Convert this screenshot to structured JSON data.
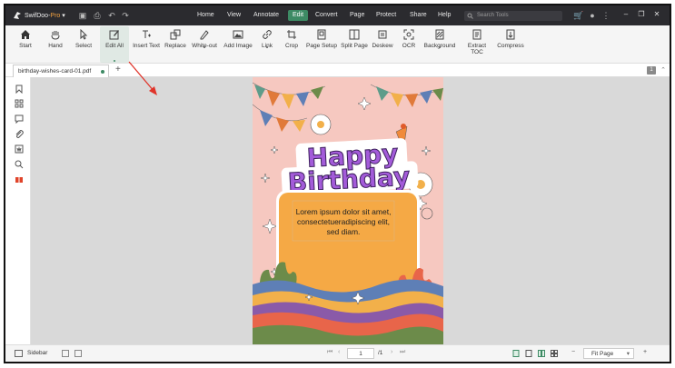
{
  "titlebar": {
    "app_name_prefix": "SwifDoo",
    "app_name_suffix": "Pro",
    "menus": [
      "Home",
      "View",
      "Annotate",
      "Edit",
      "Convert",
      "Page",
      "Protect",
      "Share",
      "Help"
    ],
    "active_menu": "Edit",
    "search_placeholder": "Search Tools"
  },
  "toolbar": {
    "tools": [
      {
        "label": "Start",
        "icon": "home-icon"
      },
      {
        "label": "Hand",
        "icon": "hand-icon"
      },
      {
        "label": "Select",
        "icon": "cursor-icon"
      },
      {
        "label": "Edit All",
        "icon": "edit-all-icon"
      },
      {
        "label": "Insert Text",
        "icon": "insert-text-icon"
      },
      {
        "label": "Replace",
        "icon": "replace-icon"
      },
      {
        "label": "White-out",
        "icon": "white-out-icon"
      },
      {
        "label": "Add Image",
        "icon": "add-image-icon"
      },
      {
        "label": "Link",
        "icon": "link-icon"
      },
      {
        "label": "Crop",
        "icon": "crop-icon"
      },
      {
        "label": "Page Setup",
        "icon": "page-setup-icon"
      },
      {
        "label": "Split Page",
        "icon": "split-page-icon"
      },
      {
        "label": "Deskew",
        "icon": "deskew-icon"
      },
      {
        "label": "OCR",
        "icon": "ocr-icon"
      },
      {
        "label": "Background",
        "icon": "background-icon"
      },
      {
        "label": "Extract TOC",
        "icon": "extract-toc-icon"
      },
      {
        "label": "Compress",
        "icon": "compress-icon"
      }
    ]
  },
  "tabs": {
    "file_name": "birthday-wishes-card-01.pdf",
    "page_count_badge": "1"
  },
  "document": {
    "title_line1": "Happy",
    "title_line2": "Birthday",
    "body_line1": "Lorem ipsum dolor sit amet,",
    "body_line2": "consectetueradipiscing elit,",
    "body_line3": "sed diam."
  },
  "statusbar": {
    "sidebar_label": "Sidebar",
    "current_page": "1",
    "total_pages": "/1",
    "zoom": "Fit Page"
  },
  "colors": {
    "accent": "#3d8a64",
    "titlebar_bg": "#2b2b2f",
    "card_bg": "#f6c8c0",
    "card_panel": "#f5a945",
    "title_purple": "#a35bd9",
    "arrow_red": "#e0342a"
  }
}
